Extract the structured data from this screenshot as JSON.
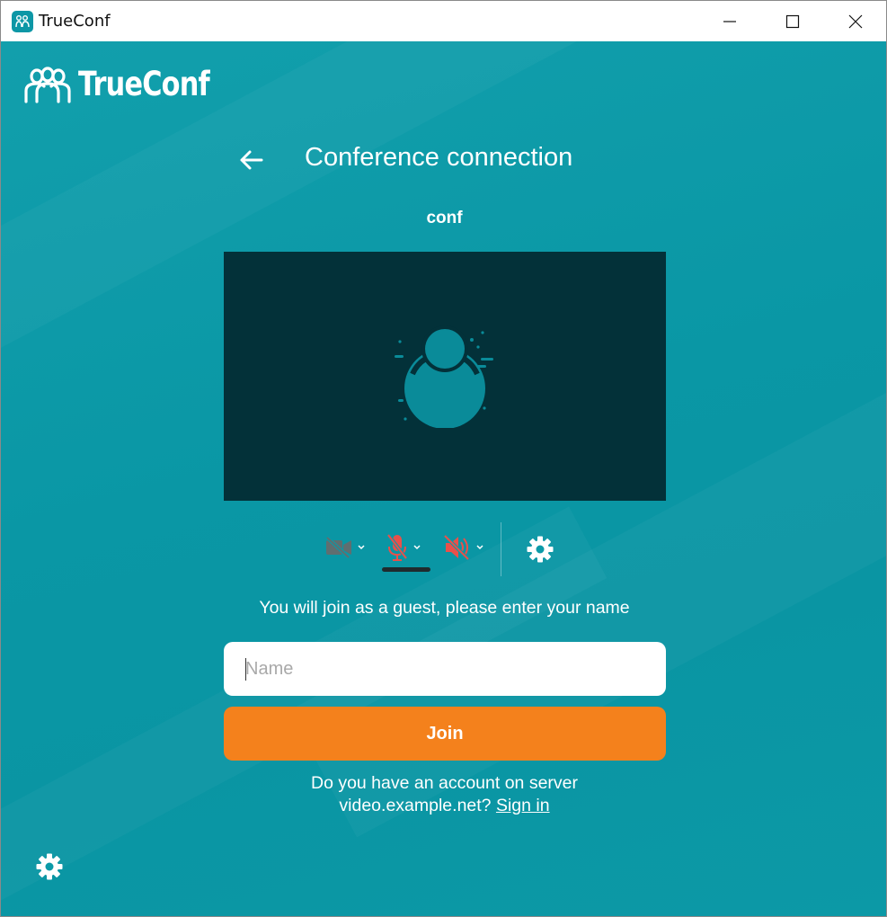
{
  "window": {
    "title": "TrueConf",
    "app_icon": "trueconf-app-icon",
    "controls": [
      "minimize-icon",
      "maximize-icon",
      "close-icon"
    ]
  },
  "brand": {
    "logo_text": "TrueConf",
    "logo_icon": "trueconf-people-logo-icon"
  },
  "header": {
    "back_icon": "arrow-left-icon",
    "title": "Conference connection"
  },
  "conference": {
    "name": "conf"
  },
  "preview": {
    "placeholder_icon": "user-avatar-icon"
  },
  "controls": {
    "camera": {
      "icon": "camera-off-icon",
      "state": "off"
    },
    "microphone": {
      "icon": "mic-off-icon",
      "state": "muted"
    },
    "speaker": {
      "icon": "speaker-off-icon",
      "state": "muted"
    },
    "settings_icon": "gear-icon"
  },
  "guest": {
    "prompt": "You will join as a guest, please enter your name",
    "name_placeholder": "Name",
    "name_value": ""
  },
  "join": {
    "label": "Join"
  },
  "account": {
    "line1": "Do you have an account on server",
    "line2_prefix": "video.example.net?",
    "sign_in_label": "Sign in"
  },
  "colors": {
    "background": "#0b9aa8",
    "preview_bg": "#033139",
    "accent_orange": "#f4811c",
    "muted_red": "#e8504a",
    "disabled_gray": "#5f6e70"
  }
}
